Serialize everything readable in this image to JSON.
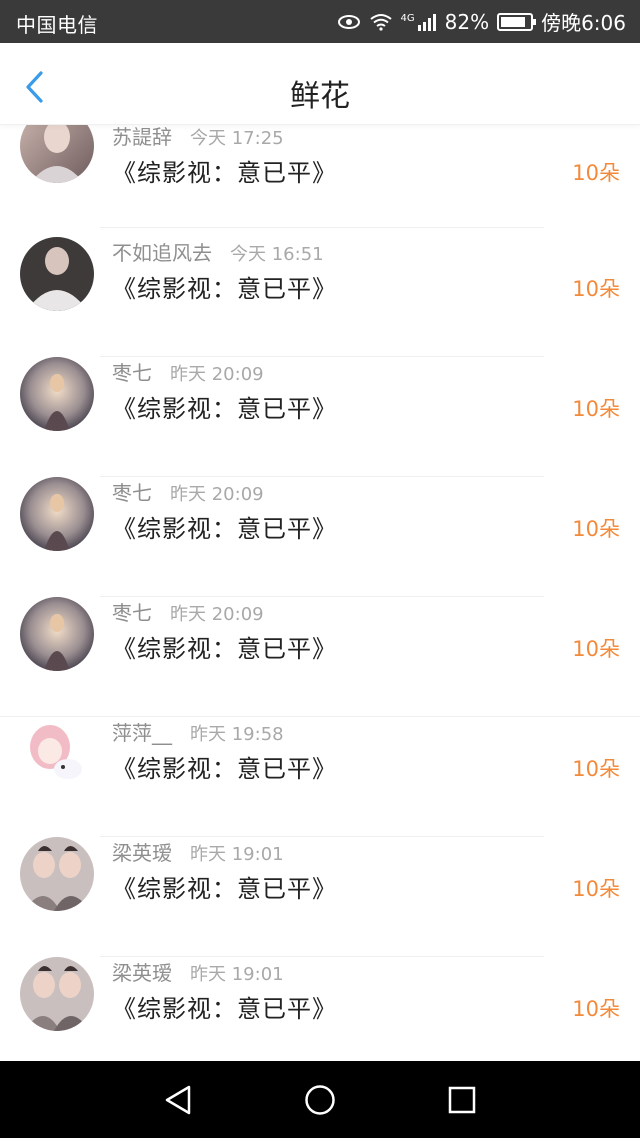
{
  "status_bar": {
    "carrier": "中国电信",
    "network": "4G",
    "battery": "82%",
    "time": "傍晚6:06"
  },
  "header": {
    "title": "鲜花"
  },
  "list": {
    "items": [
      {
        "user": "苏諟辞",
        "time": "今天 17:25",
        "book": "《综影视：意已平》",
        "amount": "10朵",
        "avatar": "avatar-photo-1"
      },
      {
        "user": "不如追风去",
        "time": "今天 16:51",
        "book": "《综影视：意已平》",
        "amount": "10朵",
        "avatar": "avatar-photo-2"
      },
      {
        "user": "枣七",
        "time": "昨天 20:09",
        "book": "《综影视：意已平》",
        "amount": "10朵",
        "avatar": "avatar-art"
      },
      {
        "user": "枣七",
        "time": "昨天 20:09",
        "book": "《综影视：意已平》",
        "amount": "10朵",
        "avatar": "avatar-art"
      },
      {
        "user": "枣七",
        "time": "昨天 20:09",
        "book": "《综影视：意已平》",
        "amount": "10朵",
        "avatar": "avatar-art"
      },
      {
        "user": "萍萍__",
        "time": "昨天 19:58",
        "book": "《综影视：意已平》",
        "amount": "10朵",
        "avatar": "avatar-anime"
      },
      {
        "user": "梁英瑷",
        "time": "昨天 19:01",
        "book": "《综影视：意已平》",
        "amount": "10朵",
        "avatar": "avatar-couple"
      },
      {
        "user": "梁英瑷",
        "time": "昨天 19:01",
        "book": "《综影视：意已平》",
        "amount": "10朵",
        "avatar": "avatar-couple"
      }
    ]
  },
  "colors": {
    "accent": "#f28a3a",
    "back_arrow": "#3a9be8",
    "status_bar": "#3a3a3a"
  }
}
